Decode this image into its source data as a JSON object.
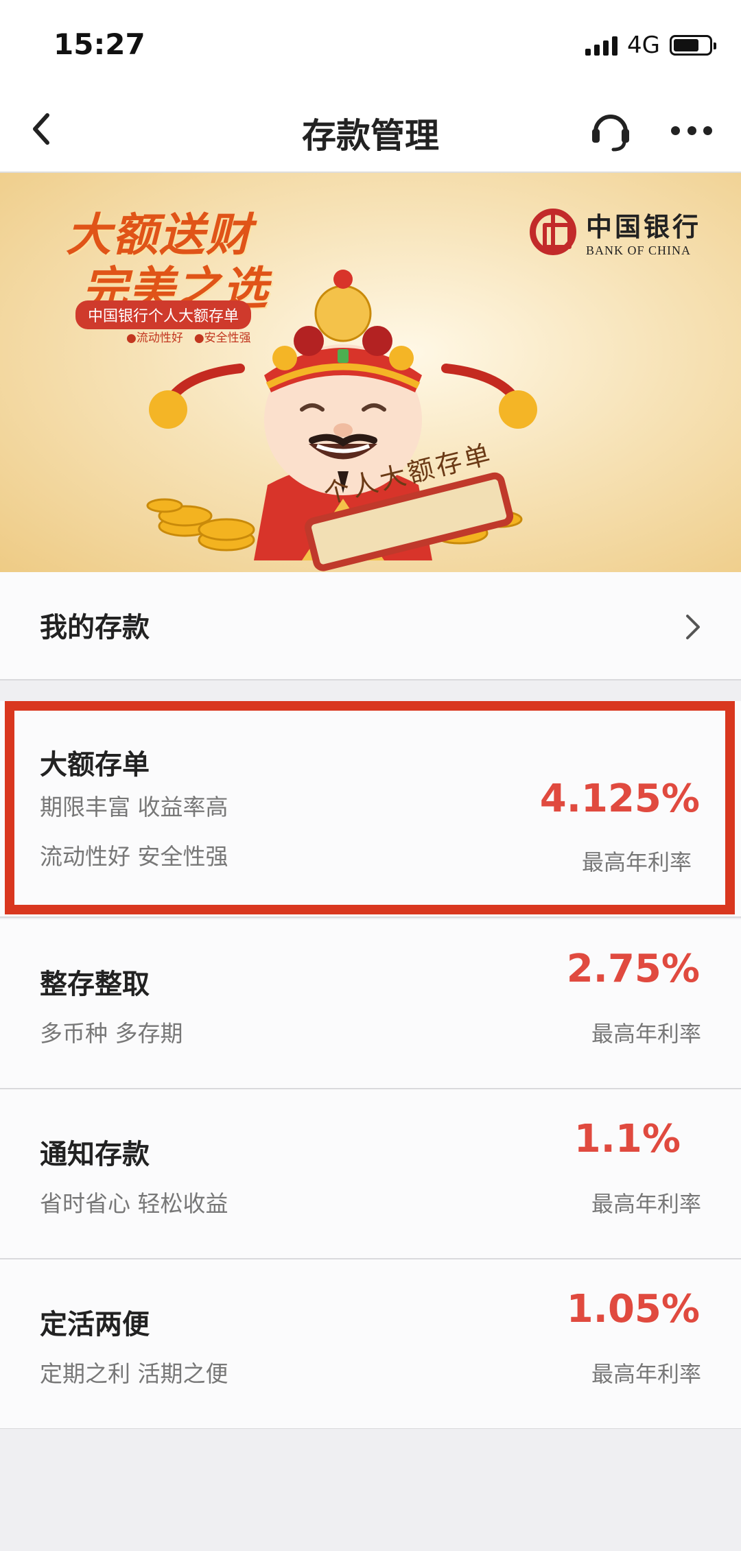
{
  "status_bar": {
    "time": "15:27",
    "network": "4G",
    "battery_level": 0.72
  },
  "nav": {
    "title": "存款管理",
    "back_icon": "chevron-left-icon",
    "service_icon": "headset-icon",
    "more_icon": "more-dots-icon"
  },
  "banner": {
    "headline_line1": "大额送财",
    "headline_line2": "完美之选",
    "pill_text": "中国银行个人大额存单",
    "tags": [
      "●流动性好",
      "●安全性强"
    ],
    "bank_name_cn": "中国银行",
    "bank_name_en": "BANK OF CHINA",
    "scroll_text": "个人大额存单"
  },
  "my_deposit": {
    "label": "我的存款"
  },
  "products": [
    {
      "title": "大额存单",
      "subtitle_lines": [
        "期限丰富 收益率高",
        "流动性好 安全性强"
      ],
      "rate": "4.125%",
      "rate_label": "最高年利率",
      "highlighted": true
    },
    {
      "title": "整存整取",
      "subtitle_lines": [
        "多币种 多存期"
      ],
      "rate": "2.75%",
      "rate_label": "最高年利率"
    },
    {
      "title": "通知存款",
      "subtitle_lines": [
        "省时省心 轻松收益"
      ],
      "rate": "1.1%",
      "rate_label": "最高年利率"
    },
    {
      "title": "定活两便",
      "subtitle_lines": [
        "定期之利 活期之便"
      ],
      "rate": "1.05%",
      "rate_label": "最高年利率"
    }
  ],
  "colors": {
    "rate_red": "#e04a3f",
    "highlight_border": "#d9371f",
    "banner_gold": "#eecb85"
  }
}
